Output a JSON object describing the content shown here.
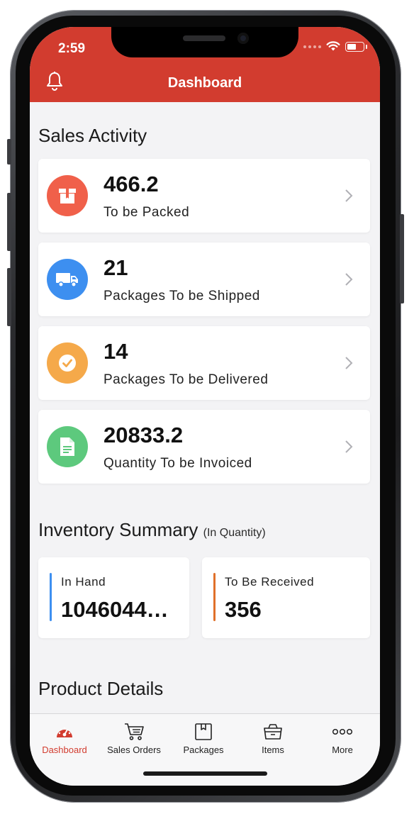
{
  "status_bar": {
    "time": "2:59"
  },
  "header": {
    "title": "Dashboard",
    "icon": "bell-icon"
  },
  "sales_activity": {
    "title": "Sales Activity",
    "items": [
      {
        "value": "466.2",
        "label": "To be Packed",
        "icon": "box-icon",
        "color": "#f0604a"
      },
      {
        "value": "21",
        "label": "Packages To be Shipped",
        "icon": "truck-icon",
        "color": "#3d8ff0"
      },
      {
        "value": "14",
        "label": "Packages To be Delivered",
        "icon": "check-badge-icon",
        "color": "#f5a94a"
      },
      {
        "value": "20833.2",
        "label": "Quantity To be Invoiced",
        "icon": "document-icon",
        "color": "#5dc97d"
      }
    ]
  },
  "inventory_summary": {
    "title": "Inventory Summary",
    "subtitle": "(In Quantity)",
    "cards": [
      {
        "label": "In Hand",
        "value": "1046044…",
        "color": "#3d8ff0"
      },
      {
        "label": "To Be Received",
        "value": "356",
        "color": "#e0702a"
      }
    ]
  },
  "product_details": {
    "title": "Product Details"
  },
  "tabbar": {
    "active_color": "#d23c2f",
    "tabs": [
      {
        "label": "Dashboard",
        "icon": "gauge-icon",
        "active": true
      },
      {
        "label": "Sales Orders",
        "icon": "cart-icon",
        "active": false
      },
      {
        "label": "Packages",
        "icon": "package-icon",
        "active": false
      },
      {
        "label": "Items",
        "icon": "basket-icon",
        "active": false
      },
      {
        "label": "More",
        "icon": "more-icon",
        "active": false
      }
    ]
  }
}
